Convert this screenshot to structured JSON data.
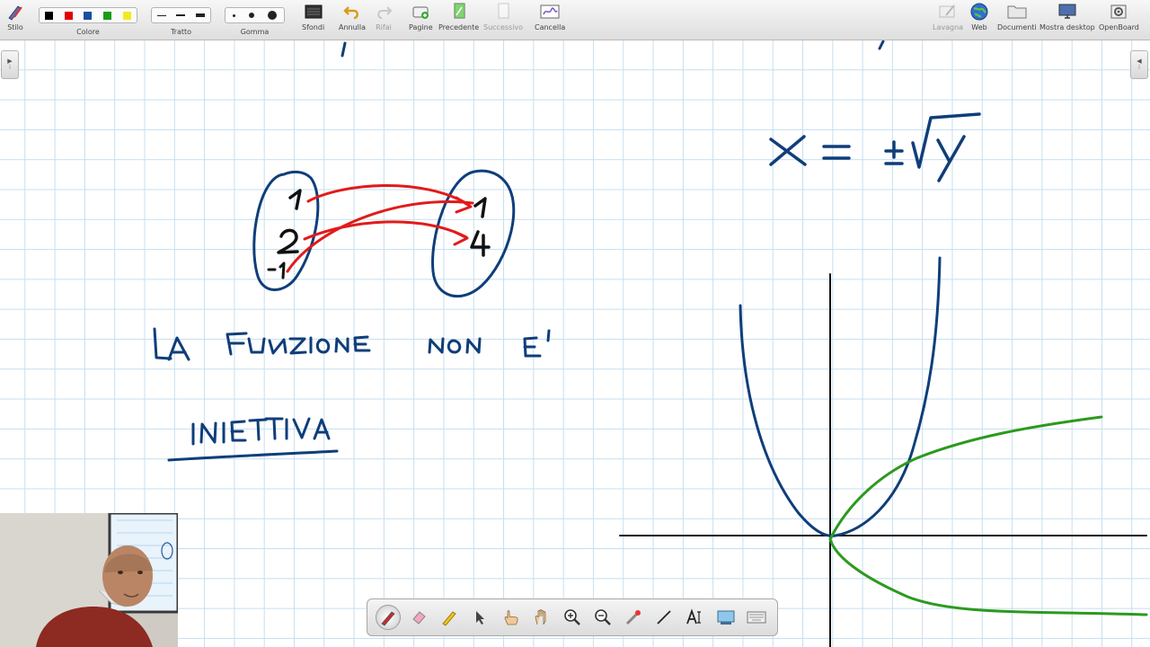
{
  "toolbar": {
    "stile": "Stilo",
    "colore": "Colore",
    "tratto": "Tratto",
    "gomma": "Gomma",
    "sfondi": "Sfondi",
    "annulla": "Annulla",
    "rifai": "Rifai",
    "pagine": "Pagine",
    "precedente": "Precedente",
    "successivo": "Successivo",
    "cancella": "Cancella",
    "lavagna": "Lavagna",
    "web": "Web",
    "documenti": "Documenti",
    "mostra_desktop": "Mostra desktop",
    "openboard": "OpenBoard"
  },
  "colors": {
    "swatches": [
      "#000000",
      "#e00000",
      "#1a4fa0",
      "#1a9a1a",
      "#f3ea1e"
    ],
    "ink_blue": "#0f3e7a",
    "ink_red": "#e11b1b",
    "ink_green": "#2c9a1e",
    "ink_black": "#111111",
    "grid": "#c6dff0"
  },
  "board": {
    "set_a": [
      "1",
      "2",
      "-1"
    ],
    "set_b": [
      "1",
      "4"
    ]
  },
  "floating_tools": [
    "pen-icon",
    "eraser-icon",
    "highlighter-icon",
    "select-arrow-icon",
    "interact-hand-icon",
    "pan-hand-icon",
    "zoom-in-icon",
    "zoom-out-icon",
    "laser-pointer-icon",
    "line-icon",
    "text-icon",
    "capture-icon",
    "keyboard-icon"
  ]
}
